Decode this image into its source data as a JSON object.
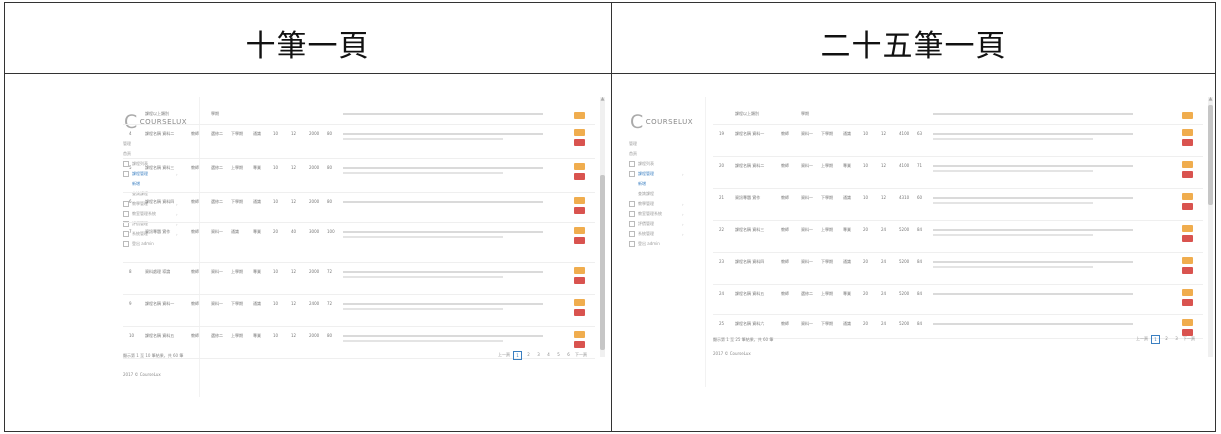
{
  "table": {
    "left_heading": "十筆一頁",
    "right_heading": "二十五筆一頁"
  },
  "app": {
    "logo_text": "COURSELUX",
    "nav": [
      {
        "label": "管理",
        "active": false
      },
      {
        "label": "首頁",
        "active": false
      },
      {
        "label": "課程列表",
        "active": false
      },
      {
        "label": "課程管理",
        "active": true,
        "chev": "›"
      },
      {
        "label": "新增",
        "active": true,
        "sub": true
      },
      {
        "label": "查詢課程",
        "active": false,
        "sub": true
      },
      {
        "label": "教學管理",
        "active": false,
        "chev": "›"
      },
      {
        "label": "教室管理系統",
        "active": false,
        "chev": "›"
      },
      {
        "label": "評價管理",
        "active": false,
        "chev": "›"
      },
      {
        "label": "系統管理",
        "active": false,
        "chev": "›"
      },
      {
        "label": "登出 admin",
        "active": false
      }
    ],
    "edit_label": "編輯",
    "delete_label": "刪除",
    "copyright": "2017 © CourseLux"
  },
  "left_list": {
    "rows": [
      {
        "id": "",
        "a": "課程以上類別",
        "b": "",
        "c": "學期",
        "d": "",
        "e": "",
        "n1": "",
        "n2": "",
        "n3": "",
        "n4": ""
      },
      {
        "id": "4",
        "a": "課程名稱 資料二",
        "b": "教師",
        "c": "選修二",
        "d": "下學期",
        "e": "通識",
        "n1": "10",
        "n2": "12",
        "n3": "2000",
        "n4": "80"
      },
      {
        "id": "5",
        "a": "課程名稱 資料三",
        "b": "教師",
        "c": "選修二",
        "d": "上學期",
        "e": "專業",
        "n1": "10",
        "n2": "12",
        "n3": "2000",
        "n4": "80"
      },
      {
        "id": "6",
        "a": "課程名稱 資料四",
        "b": "教師",
        "c": "選修二",
        "d": "下學期",
        "e": "通識",
        "n1": "10",
        "n2": "12",
        "n3": "2000",
        "n4": "80"
      },
      {
        "id": "7",
        "a": "資訊專題 實作",
        "b": "教師",
        "c": "資料一",
        "d": "通識",
        "e": "專業",
        "n1": "20",
        "n2": "40",
        "n3": "3000",
        "n4": "100"
      },
      {
        "id": "8",
        "a": "資料處理 導論",
        "b": "教師",
        "c": "資料一",
        "d": "上學期",
        "e": "專業",
        "n1": "10",
        "n2": "12",
        "n3": "2000",
        "n4": "72"
      },
      {
        "id": "9",
        "a": "課程名稱 資料一",
        "b": "教師",
        "c": "資料一",
        "d": "下學期",
        "e": "通識",
        "n1": "10",
        "n2": "12",
        "n3": "2400",
        "n4": "72"
      },
      {
        "id": "10",
        "a": "課程名稱 資料五",
        "b": "教師",
        "c": "選修二",
        "d": "上學期",
        "e": "專業",
        "n1": "10",
        "n2": "12",
        "n3": "2000",
        "n4": "80"
      }
    ],
    "summary": "顯示第 1 至 10 筆結果，共 60 筆",
    "pages": [
      "上一頁",
      "1",
      "2",
      "3",
      "4",
      "5",
      "6",
      "下一頁"
    ],
    "current_page": "1"
  },
  "right_list": {
    "rows": [
      {
        "id": "",
        "a": "課程以上類別",
        "b": "",
        "c": "學期",
        "d": "",
        "e": "",
        "n1": "",
        "n2": "",
        "n3": "",
        "n4": ""
      },
      {
        "id": "19",
        "a": "課程名稱 資料一",
        "b": "教師",
        "c": "資料一",
        "d": "下學期",
        "e": "通識",
        "n1": "10",
        "n2": "12",
        "n3": "4100",
        "n4": "63"
      },
      {
        "id": "20",
        "a": "課程名稱 資料二",
        "b": "教師",
        "c": "資料一",
        "d": "上學期",
        "e": "專業",
        "n1": "10",
        "n2": "12",
        "n3": "4100",
        "n4": "71"
      },
      {
        "id": "21",
        "a": "資訊專題 實作",
        "b": "教師",
        "c": "資料一",
        "d": "下學期",
        "e": "通識",
        "n1": "10",
        "n2": "12",
        "n3": "4310",
        "n4": "60"
      },
      {
        "id": "22",
        "a": "課程名稱 資料三",
        "b": "教師",
        "c": "資料一",
        "d": "上學期",
        "e": "專業",
        "n1": "20",
        "n2": "24",
        "n3": "5200",
        "n4": "84"
      },
      {
        "id": "23",
        "a": "課程名稱 資料四",
        "b": "教師",
        "c": "資料一",
        "d": "下學期",
        "e": "通識",
        "n1": "20",
        "n2": "24",
        "n3": "5200",
        "n4": "84"
      },
      {
        "id": "24",
        "a": "課程名稱 資料五",
        "b": "教師",
        "c": "選修二",
        "d": "上學期",
        "e": "專業",
        "n1": "20",
        "n2": "24",
        "n3": "5200",
        "n4": "84"
      },
      {
        "id": "25",
        "a": "課程名稱 資料六",
        "b": "教師",
        "c": "資料一",
        "d": "下學期",
        "e": "通識",
        "n1": "20",
        "n2": "24",
        "n3": "5200",
        "n4": "84"
      }
    ],
    "summary": "顯示第 1 至 25 筆結果，共 60 筆",
    "pages": [
      "上一頁",
      "1",
      "2",
      "3",
      "下一頁"
    ],
    "current_page": "1"
  }
}
